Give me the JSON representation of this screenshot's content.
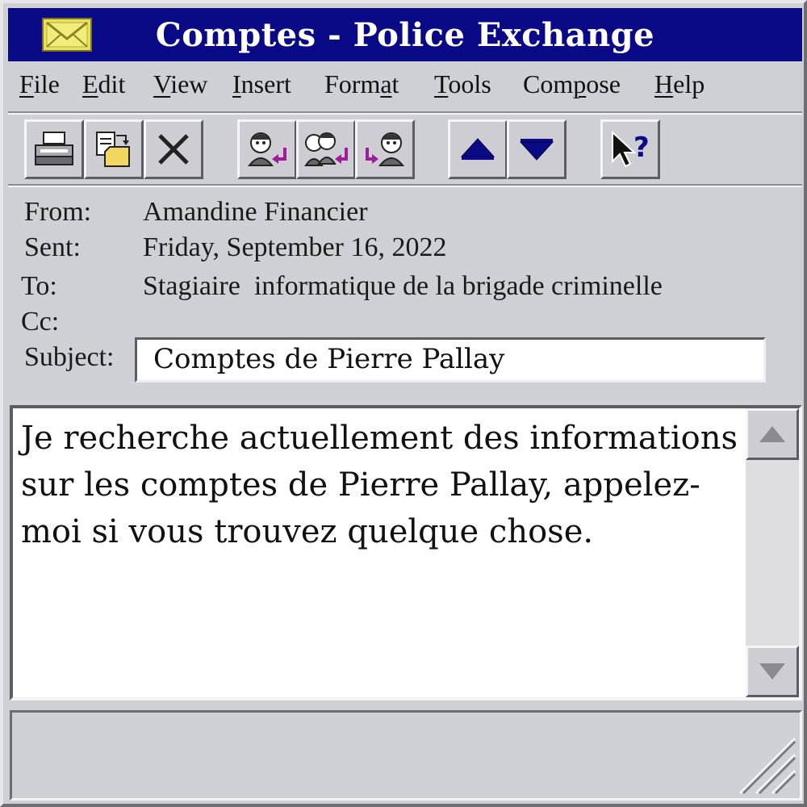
{
  "window": {
    "title": "Comptes - Police Exchange",
    "title_icon": "envelope-icon",
    "colors": {
      "titlebar": "#0a0a86",
      "titlebar_text": "#ffffff",
      "face": "#cfcfd6"
    }
  },
  "menu": [
    {
      "pre": "",
      "u": "F",
      "post": "ile"
    },
    {
      "pre": "",
      "u": "E",
      "post": "dit"
    },
    {
      "pre": "",
      "u": "V",
      "post": "iew"
    },
    {
      "pre": "",
      "u": "I",
      "post": "nsert"
    },
    {
      "pre": "Form",
      "u": "a",
      "post": "t"
    },
    {
      "pre": "",
      "u": "T",
      "post": "ools"
    },
    {
      "pre": "Com",
      "u": "p",
      "post": "ose"
    },
    {
      "pre": "",
      "u": "H",
      "post": "elp"
    }
  ],
  "toolbar": [
    {
      "name": "print-button",
      "icon": "printer-icon"
    },
    {
      "name": "move-to-folder-button",
      "icon": "folder-move-icon"
    },
    {
      "name": "delete-button",
      "icon": "delete-x-icon"
    },
    {
      "name": "reply-button",
      "icon": "reply-icon"
    },
    {
      "name": "reply-all-button",
      "icon": "reply-all-icon"
    },
    {
      "name": "forward-button",
      "icon": "forward-icon"
    },
    {
      "name": "previous-item-button",
      "icon": "arrow-up-icon"
    },
    {
      "name": "next-item-button",
      "icon": "arrow-down-icon"
    },
    {
      "name": "help-button",
      "icon": "help-pointer-icon"
    }
  ],
  "header": {
    "from_label": "From:",
    "from_value": "Amandine Financier",
    "sent_label": "Sent:",
    "sent_value": "Friday, September 16, 2022",
    "to_label": "To:",
    "to_value": "Stagiaire  informatique de la brigade criminelle",
    "cc_label": "Cc:",
    "cc_value": "",
    "subject_label": "Subject:",
    "subject_value": "Comptes de Pierre Pallay"
  },
  "body": {
    "text": "Je recherche actuellement des informations sur les comptes de Pierre Pallay, appelez-moi si vous trouvez quelque chose."
  },
  "status": {
    "text": ""
  }
}
